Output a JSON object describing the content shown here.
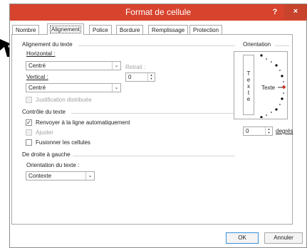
{
  "window": {
    "title": "Format de cellule",
    "help_label": "?",
    "close_label": "×"
  },
  "tabs": [
    "Nombre",
    "Alignement",
    "Police",
    "Bordure",
    "Remplissage",
    "Protection"
  ],
  "alignment": {
    "section_title": "Alignement du texte",
    "horizontal_label": "Horizontal :",
    "horizontal_value": "Centré",
    "indent_label": "Retrait :",
    "indent_value": "0",
    "vertical_label": "Vertical :",
    "vertical_value": "Centré",
    "justify_distributed_label": "Justification distribuée"
  },
  "text_control": {
    "section_title": "Contrôle du texte",
    "wrap_label": "Renvoyer à la ligne automatiquement",
    "wrap_checked": true,
    "shrink_label": "Ajuster",
    "merge_label": "Fusionner les cellules"
  },
  "rtl": {
    "section_title": "De droite à gauche",
    "direction_label": "Orientation du texte :",
    "direction_value": "Contexte"
  },
  "orientation": {
    "section_title": "Orientation",
    "vertical_text_chars": [
      "T",
      "e",
      "x",
      "t",
      "e"
    ],
    "dial_label": "Texte",
    "degrees_value": "0",
    "degrees_label": "degrés"
  },
  "footer": {
    "ok_label": "OK",
    "cancel_label": "Annuler"
  },
  "colors": {
    "titlebar": "#d8432d",
    "marker": "#c0392b"
  }
}
